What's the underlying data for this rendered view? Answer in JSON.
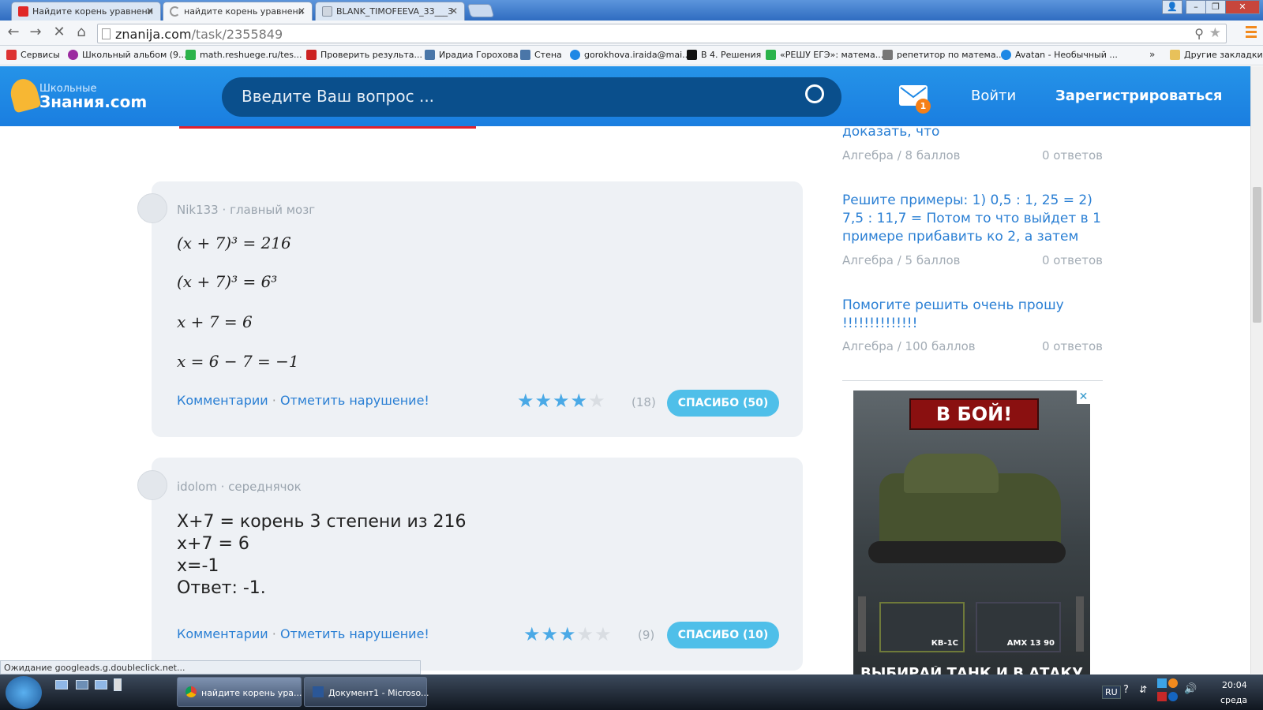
{
  "browser": {
    "tabs": [
      {
        "title": "Найдите корень уравнени",
        "favicon_color": "#e02727"
      },
      {
        "title": "найдите корень уравнени",
        "favicon_color": "#999999"
      },
      {
        "title": "BLANK_TIMOFEEVA_33___3",
        "favicon_color": "#cfd6e0"
      }
    ],
    "url_host": "znanija.com",
    "url_path": "/task/2355849",
    "bookmarks": [
      {
        "label": "Сервисы",
        "color": "#d33"
      },
      {
        "label": "Школьный альбом (9...",
        "color": "#9b2aa0"
      },
      {
        "label": "math.reshuege.ru/tes...",
        "color": "#2bb34b"
      },
      {
        "label": "Проверить результа...",
        "color": "#c22"
      },
      {
        "label": "Ирадиа Горохова",
        "color": "#4a76a8"
      },
      {
        "label": "Стена",
        "color": "#4a76a8"
      },
      {
        "label": "gorokhova.iraida@mai...",
        "color": "#1e88e5"
      },
      {
        "label": "В 4. Решения",
        "color": "#111"
      },
      {
        "label": "«РЕШУ ЕГЭ»: матема...",
        "color": "#2bb34b"
      },
      {
        "label": "репетитор по матема...",
        "color": "#777"
      },
      {
        "label": "Avatan - Необычный ...",
        "color": "#1e88e5"
      }
    ],
    "bookmarks_more": "»",
    "other_bookmarks": "Другие закладки",
    "status": "Ожидание googleads.g.doubleclick.net..."
  },
  "site": {
    "logo_top": "Школьные",
    "logo_bottom": "Знания.com",
    "search_placeholder": "Введите Ваш вопрос ...",
    "mail_count": "1",
    "login": "Войти",
    "register": "Зарегистрироваться"
  },
  "answers": [
    {
      "author": "Nik133",
      "rank": "главный мозг",
      "lines": [
        "(x + 7)³ = 216",
        "(x + 7)³ = 6³",
        "x + 7 = 6",
        "x = 6 − 7 = −1"
      ],
      "rating": 4,
      "votes": "(18)",
      "thanks": "СПАСИБО (50)"
    },
    {
      "author": "idolom",
      "rank": "середнячок",
      "lines": [
        "Х+7 = корень 3 степени из 216",
        "х+7 = 6",
        "х=-1",
        "Ответ: -1."
      ],
      "rating": 3,
      "votes": "(9)",
      "thanks": "СПАСИБО (10)"
    }
  ],
  "actions": {
    "comments": "Комментарии",
    "separator": "·",
    "report": "Отметить нарушение!",
    "rank_separator": "·"
  },
  "sidebar": [
    {
      "question": "доказать, что",
      "subject": "Алгебра",
      "points": "8 баллов",
      "answers": "0 ответов"
    },
    {
      "question": "Решите примеры: 1) 0,5 : 1, 25 = 2) 7,5 : 11,7 = Потом то что выйдет в 1 примере прибавить ко 2, а затем",
      "subject": "Алгебра",
      "points": "5 баллов",
      "answers": "0 ответов"
    },
    {
      "question": "Помогите решить очень прошу !!!!!!!!!!!!!!",
      "subject": "Алгебра",
      "points": "100 баллов",
      "answers": "0 ответов"
    }
  ],
  "meta_separator": "/",
  "ad": {
    "button": "В БОЙ!",
    "tanks": [
      "КВ-1С",
      "AMX 13 90"
    ],
    "close": "✕",
    "footer": "ВЫБИРАЙ ТАНК И В АТАКУ"
  },
  "taskbar": {
    "tasks": [
      "найдите корень ура...",
      "Документ1 - Microso..."
    ],
    "lang": "RU",
    "time": "20:04",
    "day": "среда"
  }
}
